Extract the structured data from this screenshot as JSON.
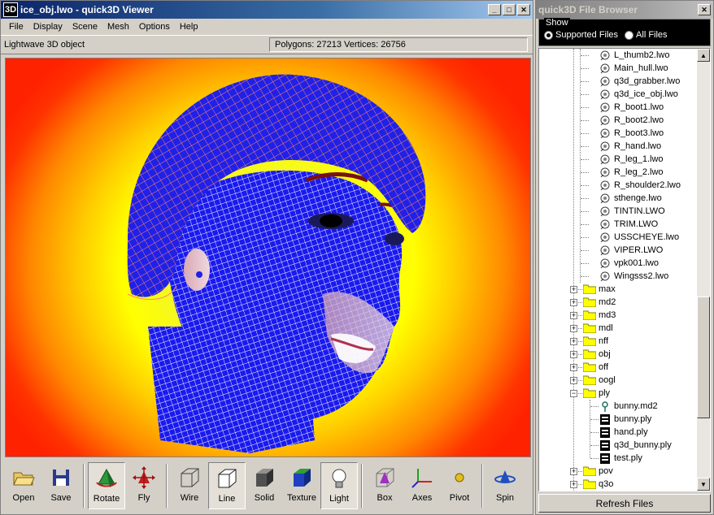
{
  "viewer": {
    "logo": "3D",
    "title": "ice_obj.lwo - quick3D Viewer",
    "menu": [
      "File",
      "Display",
      "Scene",
      "Mesh",
      "Options",
      "Help"
    ],
    "object_type": "Lightwave 3D object",
    "stats": "Polygons: 27213  Vertices: 26756",
    "toolbar": {
      "open": "Open",
      "save": "Save",
      "rotate": "Rotate",
      "fly": "Fly",
      "wire": "Wire",
      "line": "Line",
      "solid": "Solid",
      "texture": "Texture",
      "light": "Light",
      "box": "Box",
      "axes": "Axes",
      "pivot": "Pivot",
      "spin": "Spin"
    }
  },
  "browser": {
    "title": "quick3D File Browser",
    "show_label": "Show",
    "supported": "Supported Files",
    "all": "All Files",
    "refresh": "Refresh Files",
    "lwo_files": [
      "L_thumb2.lwo",
      "Main_hull.lwo",
      "q3d_grabber.lwo",
      "q3d_ice_obj.lwo",
      "R_boot1.lwo",
      "R_boot2.lwo",
      "R_boot3.lwo",
      "R_hand.lwo",
      "R_leg_1.lwo",
      "R_leg_2.lwo",
      "R_shoulder2.lwo",
      "sthenge.lwo",
      "TINTIN.LWO",
      "TRIM.LWO",
      "USSCHEYE.lwo",
      "VIPER.LWO",
      "vpk001.lwo",
      "Wingsss2.lwo"
    ],
    "folders_a": [
      "max",
      "md2",
      "md3",
      "mdl",
      "nff",
      "obj",
      "off",
      "oogl"
    ],
    "ply_folder": "ply",
    "ply_files": [
      "bunny.md2",
      "bunny.ply",
      "hand.ply",
      "q3d_bunny.ply",
      "test.ply"
    ],
    "folders_b": [
      "pov",
      "q3o"
    ]
  }
}
